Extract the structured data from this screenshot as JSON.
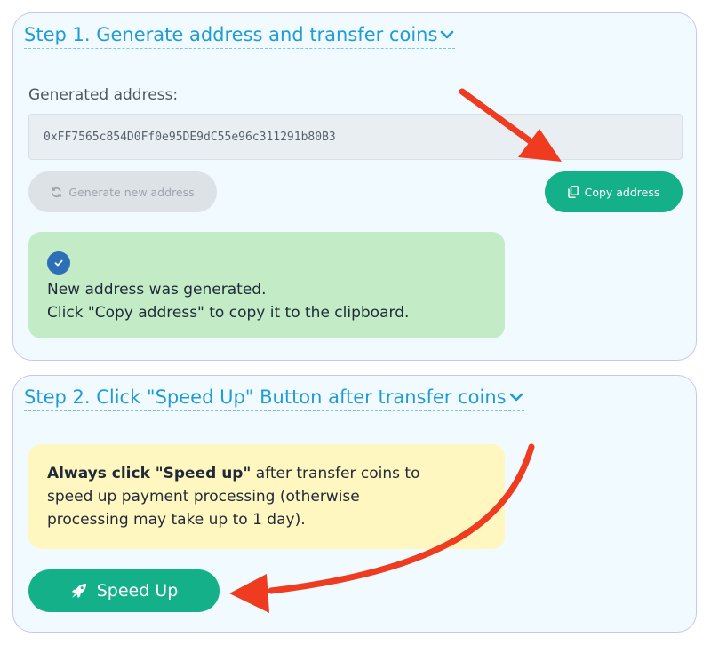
{
  "colors": {
    "accent_teal": "#14b08a",
    "title_blue": "#1f9bd6",
    "success_bg": "#c3ecc6",
    "warning_bg": "#fff6c0",
    "arrow_red": "#ef3b1f",
    "panel_border": "#c9c5ee"
  },
  "step1": {
    "title": "Step 1. Generate address and transfer coins",
    "title_icon": "chevron-down-icon",
    "address_label": "Generated address:",
    "address_value": "0xFF7565c854D0Ff0e95DE9dC55e96c311291b80B3",
    "generate_button": {
      "label": "Generate new address",
      "icon": "refresh-icon"
    },
    "copy_button": {
      "label": "Copy address",
      "icon": "copy-icon"
    },
    "success_alert": {
      "icon": "check-icon",
      "line1": "New address was generated.",
      "line2": "Click \"Copy address\" to copy it to the clipboard."
    }
  },
  "step2": {
    "title": "Step 2. Click \"Speed Up\" Button after transfer coins",
    "title_icon": "chevron-down-icon",
    "warning_alert": {
      "bold": "Always click \"Speed up\"",
      "text_after_bold": " after transfer coins to",
      "line2": "speed up payment processing (otherwise",
      "line3": "processing may take up to 1 day)."
    },
    "speed_up_button": {
      "label": "Speed Up",
      "icon": "rocket-icon"
    }
  },
  "annotations": {
    "arrow_to_copy": "arrow-icon",
    "arrow_to_speed_up": "arrow-icon"
  }
}
